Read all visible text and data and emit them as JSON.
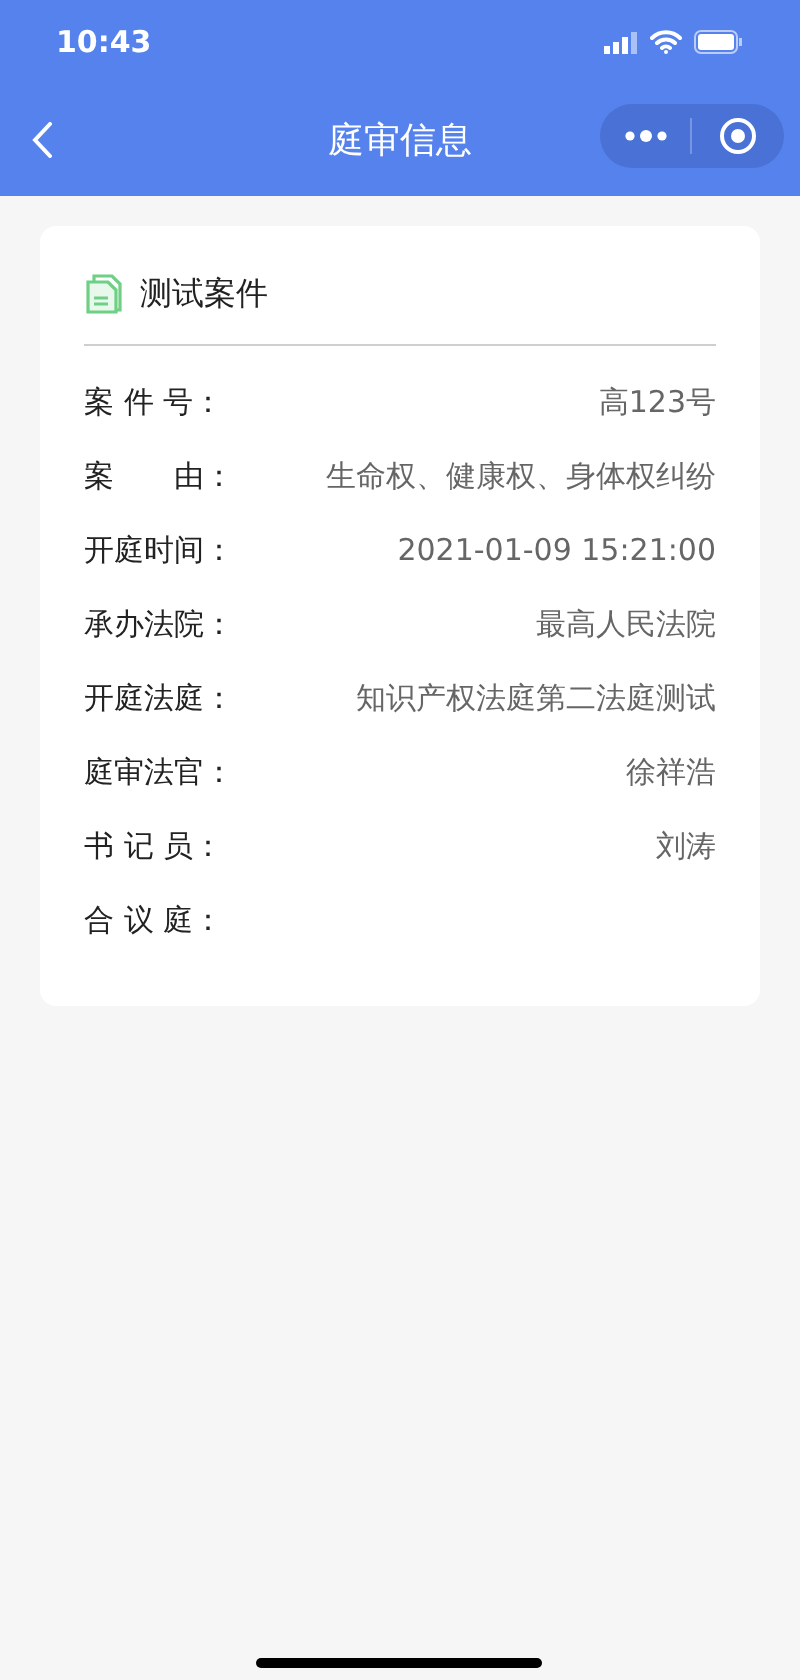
{
  "status_bar": {
    "time": "10:43"
  },
  "nav_bar": {
    "title": "庭审信息"
  },
  "card": {
    "title": "测试案件",
    "fields": [
      {
        "label": "案 件 号：",
        "value": "高123号"
      },
      {
        "label": "案　　由：",
        "value": "生命权、健康权、身体权纠纷"
      },
      {
        "label": "开庭时间：",
        "value": "2021-01-09 15:21:00"
      },
      {
        "label": "承办法院：",
        "value": "最高人民法院"
      },
      {
        "label": "开庭法庭：",
        "value": "知识产权法庭第二法庭测试"
      },
      {
        "label": "庭审法官：",
        "value": "徐祥浩"
      },
      {
        "label": "书 记 员：",
        "value": "刘涛"
      },
      {
        "label": "合 议 庭："
      }
    ]
  }
}
